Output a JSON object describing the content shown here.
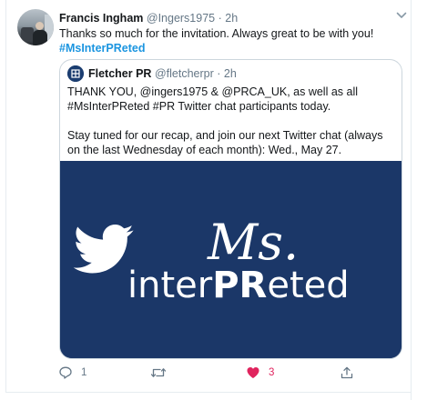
{
  "tweet": {
    "author_name": "Francis Ingham",
    "author_handle": "@Ingers1975",
    "separator": "·",
    "timestamp": "2h",
    "text": "Thanks so much for the invitation. Always great to be with you!",
    "hashtag": "#MsInterPReted",
    "actions": {
      "reply_count": "1",
      "retweet_count": "",
      "like_count": "3"
    }
  },
  "quoted_tweet": {
    "author_name": "Fletcher PR",
    "author_handle": "@fletcherpr",
    "separator": "·",
    "timestamp": "2h",
    "paragraph_1": "THANK YOU, @ingers1975 & @PRCA_UK, as well as all #MsInterPReted #PR Twitter chat participants today.",
    "paragraph_2": "Stay tuned for our recap, and join our next Twitter chat (always on the last Wednesday of each month): Wed., May 27.",
    "image": {
      "logo_script_text": "Ms.",
      "logo_text_prefix": "inter",
      "logo_text_bold": "PR",
      "logo_text_suffix": "eted",
      "background_color": "#1b3768"
    }
  },
  "colors": {
    "accent": "#1b95e0",
    "like": "#e0245e",
    "muted": "#657786"
  }
}
